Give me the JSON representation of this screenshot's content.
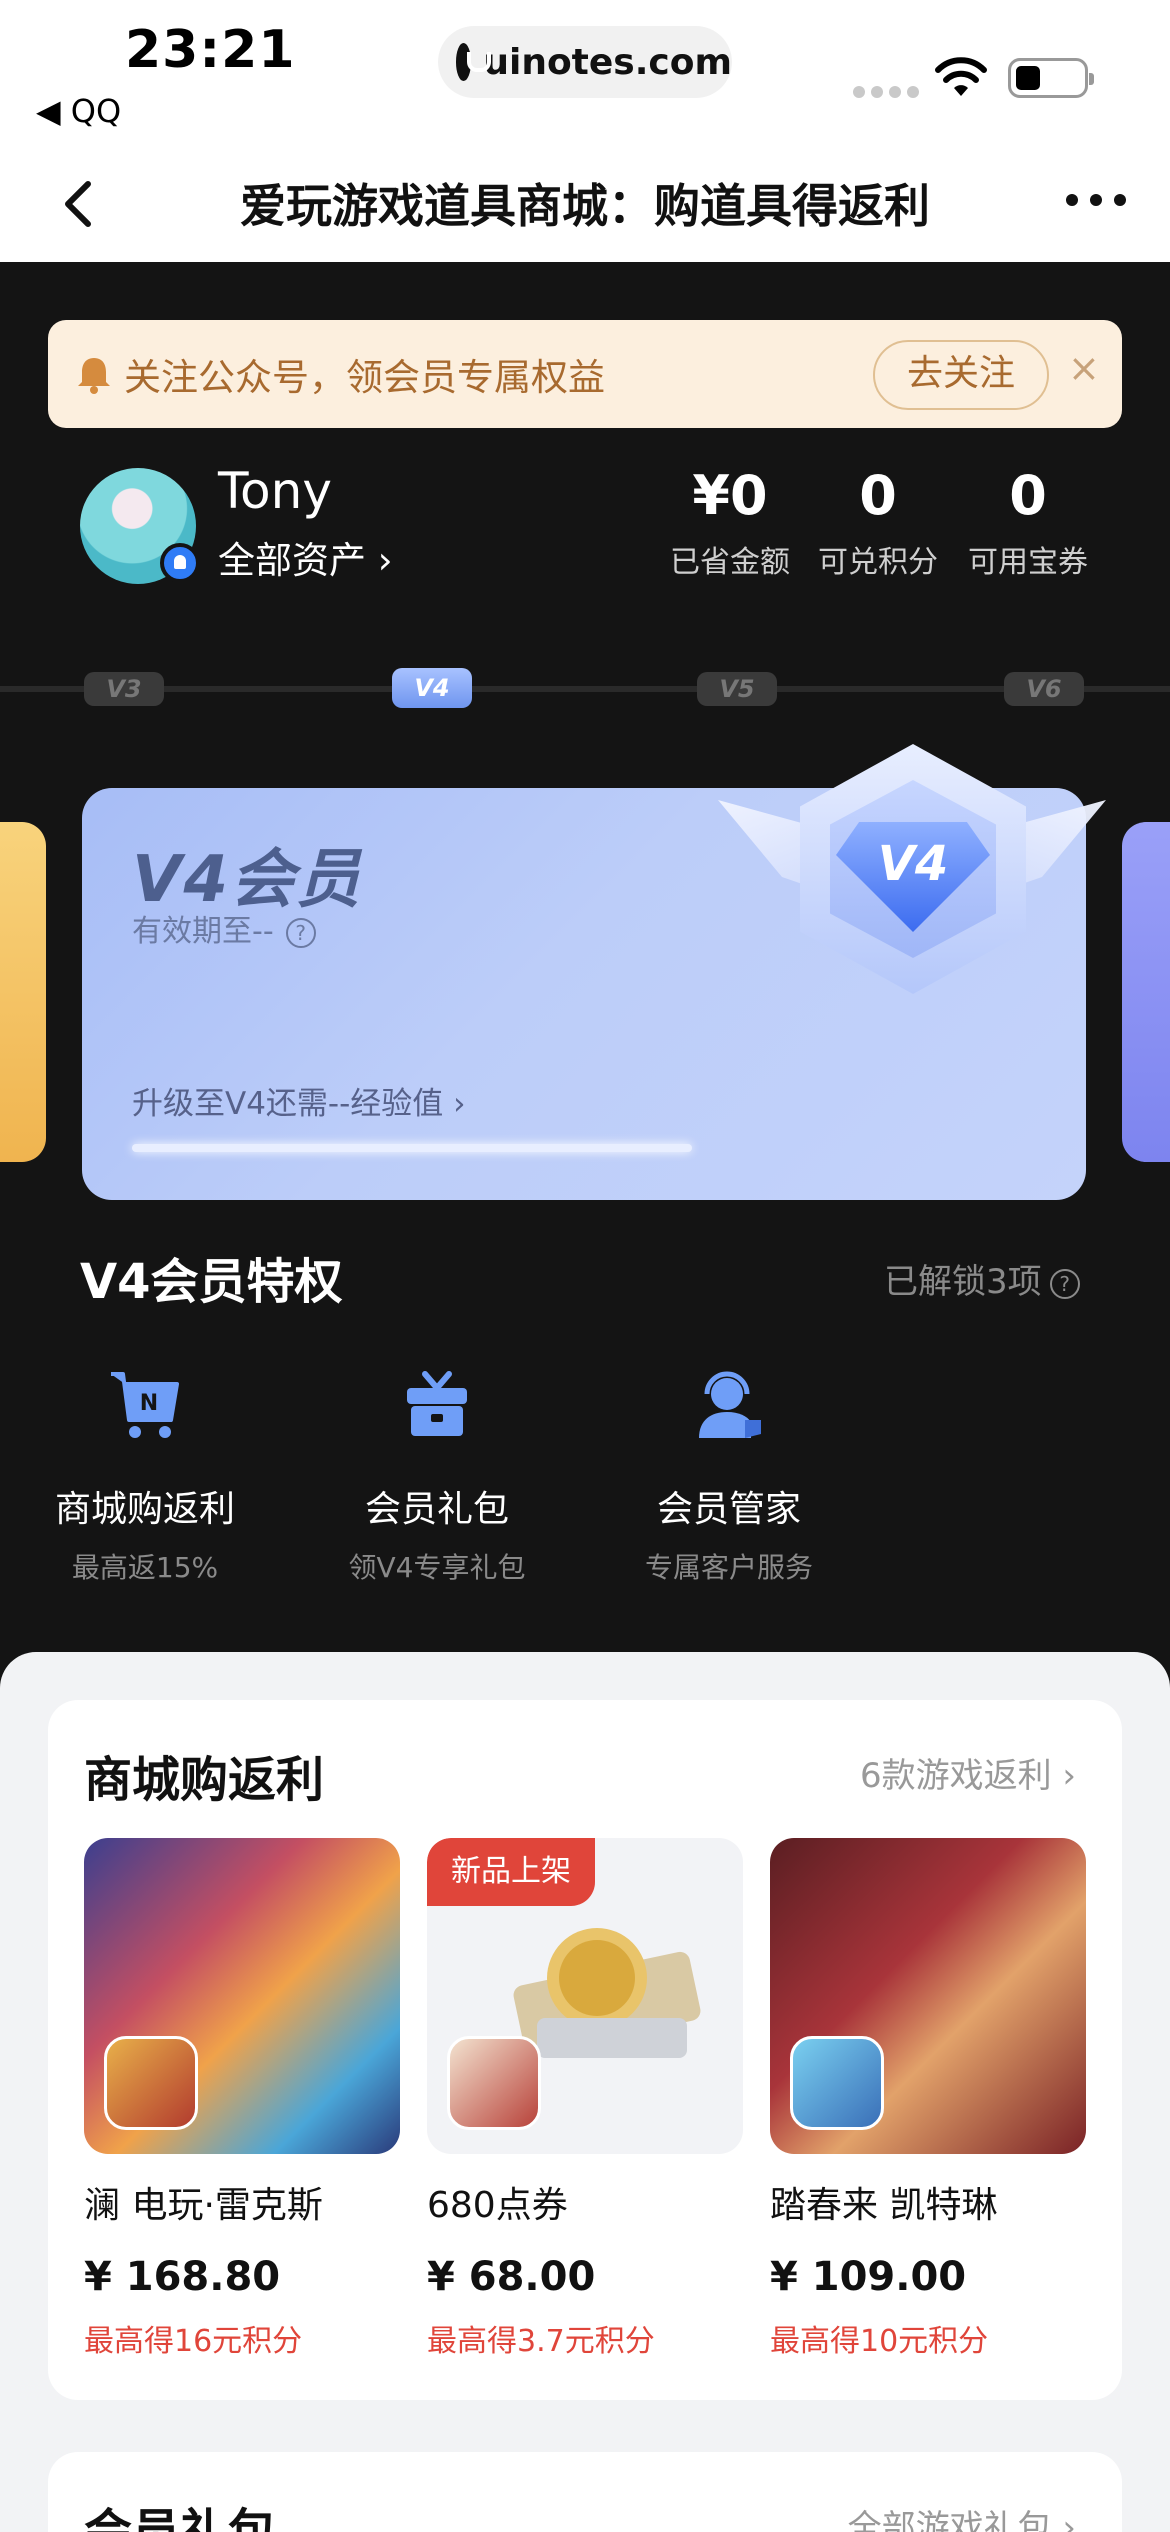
{
  "status_bar": {
    "time": "23:21",
    "back_app": "◀ QQ",
    "url": "uinotes.com"
  },
  "nav": {
    "title": "爱玩游戏道具商城：购道具得返利"
  },
  "notice": {
    "text": "关注公众号，领会员专属权益",
    "button": "去关注",
    "close": "×"
  },
  "profile": {
    "name": "Tony",
    "assets_link": "全部资产 ›",
    "stats": [
      {
        "value": "¥0",
        "label": "已省金额"
      },
      {
        "value": "0",
        "label": "可兑积分"
      },
      {
        "value": "0",
        "label": "可用宝券"
      }
    ]
  },
  "levels": [
    "V3",
    "V4",
    "V5",
    "V6"
  ],
  "active_level": "V4",
  "member_card": {
    "title": "V4会员",
    "valid_until": "有效期至--",
    "upgrade_text": "升级至V4还需--经验值 ›",
    "badge": "V4"
  },
  "privileges": {
    "title": "V4会员特权",
    "unlocked": "已解锁3项",
    "items": [
      {
        "label": "商城购返利",
        "sub": "最高返15%",
        "icon": "cart-icon"
      },
      {
        "label": "会员礼包",
        "sub": "领V4专享礼包",
        "icon": "gift-icon"
      },
      {
        "label": "会员管家",
        "sub": "专属客户服务",
        "icon": "support-agent-icon"
      }
    ]
  },
  "shop_section": {
    "title": "商城购返利",
    "more": "6款游戏返利 ›",
    "products": [
      {
        "name": "澜 电玩·雷克斯",
        "price": "¥ 168.80",
        "reward": "最高得16元积分",
        "tag": ""
      },
      {
        "name": "680点券",
        "price": "¥ 68.00",
        "reward": "最高得3.7元积分",
        "tag": "新品上架"
      },
      {
        "name": "踏春来 凯特琳",
        "price": "¥ 109.00",
        "reward": "最高得10元积分",
        "tag": ""
      }
    ]
  },
  "gift_section": {
    "title": "会员礼包",
    "more": "全部游戏礼包 ›"
  },
  "colors": {
    "accent_red": "#e0453a",
    "card_blue": "#a7bdf6",
    "notice_bg": "#fcefde"
  }
}
